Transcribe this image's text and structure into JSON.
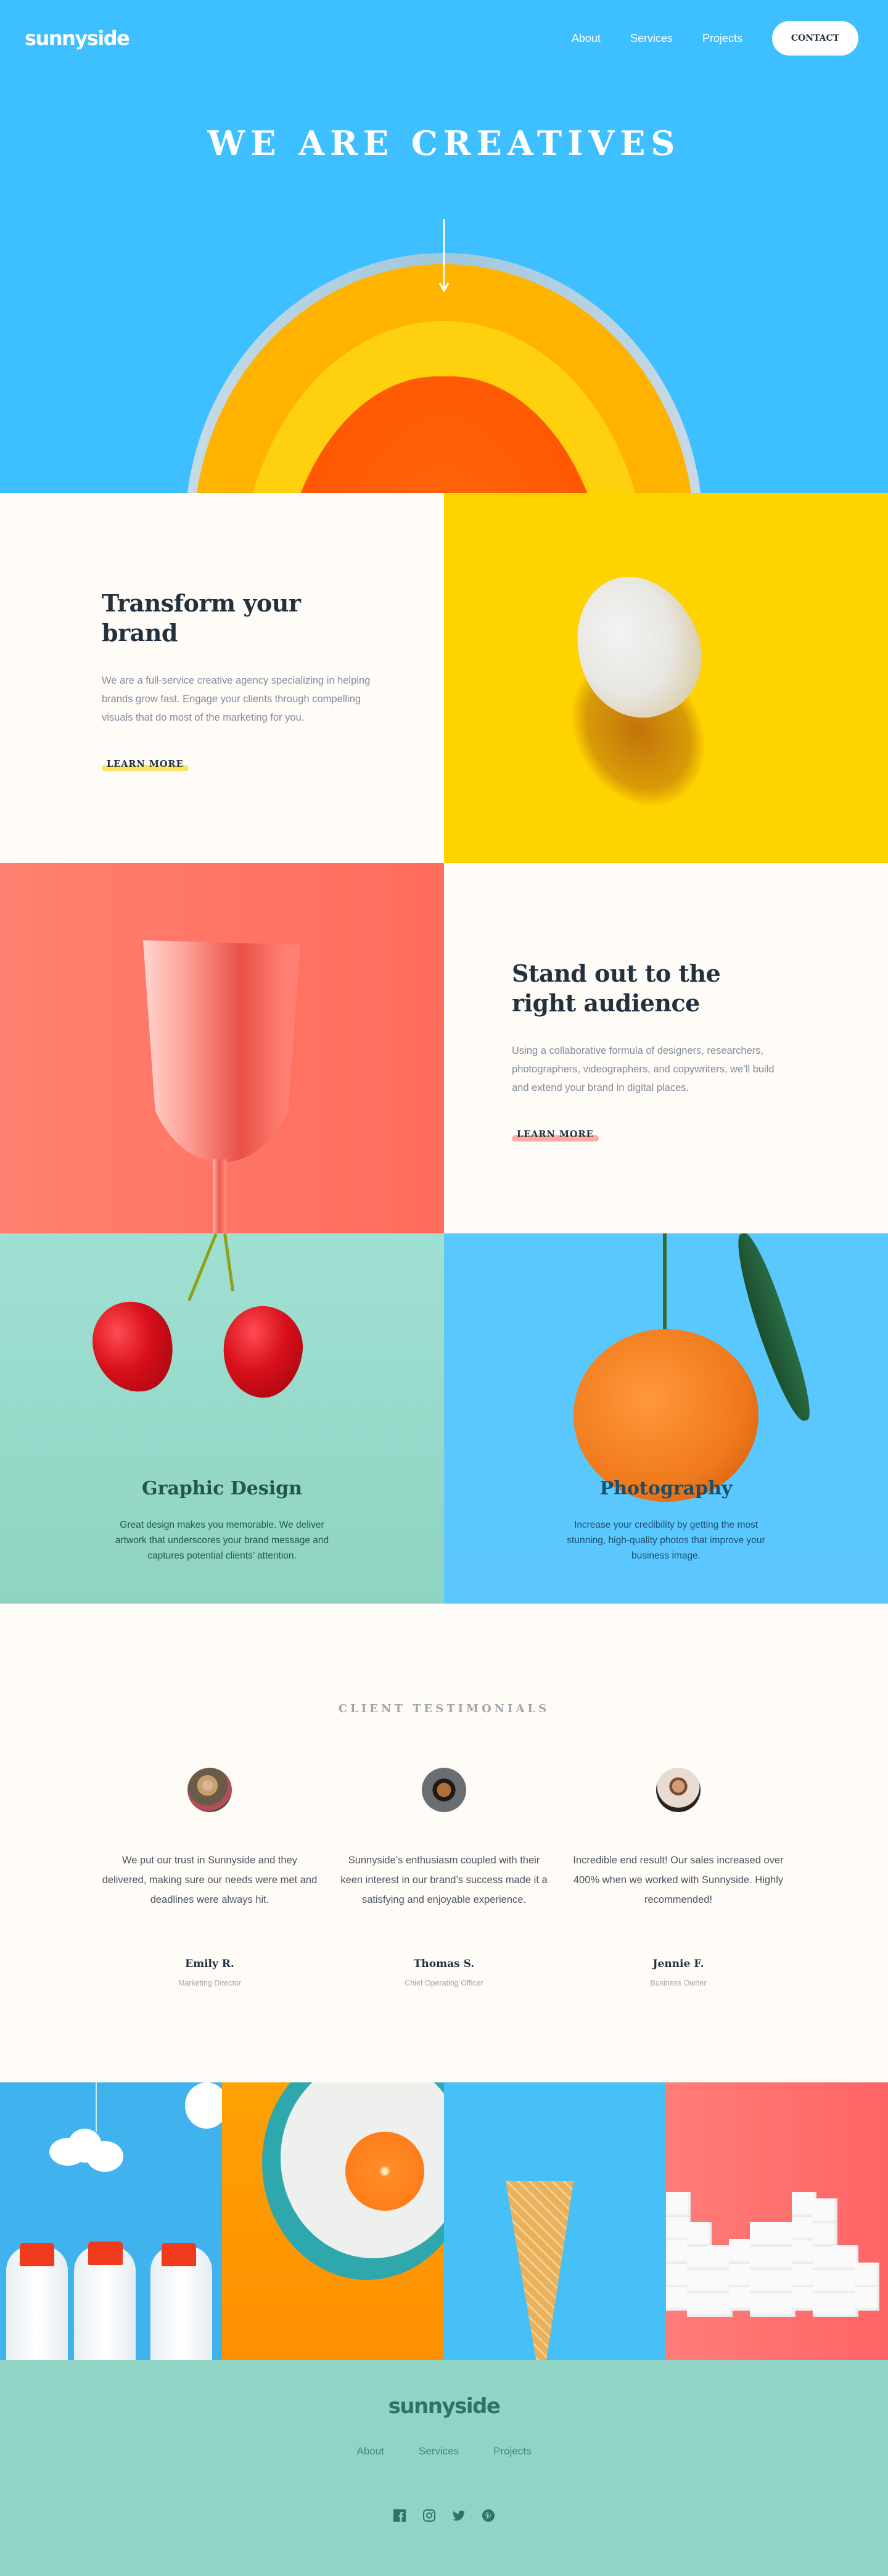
{
  "brand": {
    "logo": "sunnyside"
  },
  "nav": {
    "links": [
      "About",
      "Services",
      "Projects"
    ],
    "contact_label": "CONTACT"
  },
  "hero": {
    "title": "WE ARE CREATIVES",
    "arrow_icon": "arrow-down-icon"
  },
  "features": [
    {
      "title": "Transform your brand",
      "body": "We are a full-service creative agency specializing in helping brands grow fast. Engage your clients through compelling visuals that do most of the marketing for you.",
      "cta": "LEARN MORE",
      "underline_color": "#fad400",
      "image": "egg"
    },
    {
      "title": "Stand out to the right audience",
      "body": "Using a collaborative formula of designers, researchers, photographers, videographers, and copywriters, we’ll build and extend your brand in digital places.",
      "cta": "LEARN MORE",
      "underline_color": "#fe7865",
      "image": "glass"
    }
  ],
  "services": [
    {
      "title": "Graphic Design",
      "body": "Great design makes you memorable. We deliver artwork that underscores your brand message and captures potential clients’ attention.",
      "image": "cherries"
    },
    {
      "title": "Photography",
      "body": "Increase your credibility by getting the most stunning, high-quality photos that improve your business image.",
      "image": "orange"
    }
  ],
  "testimonials": {
    "heading": "CLIENT TESTIMONIALS",
    "items": [
      {
        "quote": "We put our trust in Sunnyside and they delivered, making sure our needs were met and deadlines were always hit.",
        "name": "Emily R.",
        "role": "Marketing Director"
      },
      {
        "quote": "Sunnyside’s enthusiasm coupled with their keen interest in our brand’s success made it a satisfying and enjoyable experience.",
        "name": "Thomas S.",
        "role": "Chief Operating Officer"
      },
      {
        "quote": "Incredible end result! Our sales increased over 400% when we worked with Sunnyside. Highly recommended!",
        "name": "Jennie F.",
        "role": "Business Owner"
      }
    ]
  },
  "gallery": [
    "milk-bottles",
    "orange-on-plate",
    "ice-cream-cone",
    "sugar-cubes"
  ],
  "footer": {
    "logo": "sunnyside",
    "links": [
      "About",
      "Services",
      "Projects"
    ],
    "social": [
      "facebook-icon",
      "instagram-icon",
      "twitter-icon",
      "pinterest-icon"
    ]
  },
  "colors": {
    "hero_bg": "#3ebfff",
    "yellow": "#fad400",
    "coral": "#fe7865",
    "dark_text": "#23303e",
    "footer_bg": "#90d4c5",
    "footer_text": "#2c7566"
  }
}
